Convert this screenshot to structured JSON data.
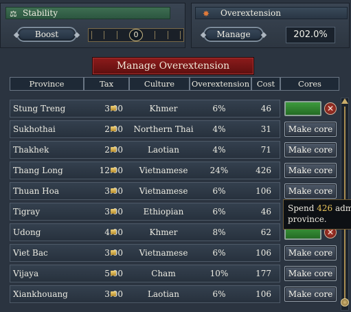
{
  "stability": {
    "title": "Stability",
    "boost_label": "Boost",
    "value": "0"
  },
  "overextension": {
    "title": "Overextension",
    "manage_label": "Manage",
    "value": "202.0%"
  },
  "panel": {
    "title": "Manage Overextension"
  },
  "table": {
    "headers": [
      "Province",
      "Tax",
      "Culture",
      "Overextension",
      "Cost",
      "Cores"
    ],
    "make_core_label": "Make core",
    "rows": [
      {
        "province": "Stung Treng",
        "tax": "3.00",
        "culture": "Khmer",
        "overextension": "6%",
        "cost": "46",
        "action": "coring"
      },
      {
        "province": "Sukhothai",
        "tax": "2.00",
        "culture": "Northern Thai",
        "overextension": "4%",
        "cost": "31",
        "action": "make-core"
      },
      {
        "province": "Thakhek",
        "tax": "2.00",
        "culture": "Laotian",
        "overextension": "4%",
        "cost": "71",
        "action": "make-core"
      },
      {
        "province": "Thang Long",
        "tax": "12.00",
        "culture": "Vietnamese",
        "overextension": "24%",
        "cost": "426",
        "action": "make-core"
      },
      {
        "province": "Thuan Hoa",
        "tax": "3.00",
        "culture": "Vietnamese",
        "overextension": "6%",
        "cost": "106",
        "action": "make-core"
      },
      {
        "province": "Tigray",
        "tax": "3.00",
        "culture": "Ethiopian",
        "overextension": "6%",
        "cost": "46",
        "action": "hidden"
      },
      {
        "province": "Udong",
        "tax": "4.00",
        "culture": "Khmer",
        "overextension": "8%",
        "cost": "62",
        "action": "coring"
      },
      {
        "province": "Viet Bac",
        "tax": "3.00",
        "culture": "Vietnamese",
        "overextension": "6%",
        "cost": "106",
        "action": "make-core"
      },
      {
        "province": "Vijaya",
        "tax": "5.00",
        "culture": "Cham",
        "overextension": "10%",
        "cost": "177",
        "action": "make-core"
      },
      {
        "province": "Xiankhouang",
        "tax": "3.00",
        "culture": "Laotian",
        "overextension": "6%",
        "cost": "106",
        "action": "make-core"
      }
    ]
  },
  "tooltip": {
    "prefix": "Spend ",
    "amount": "426",
    "suffix": " adm",
    "line2": "province."
  },
  "colors": {
    "background": "#2b3440",
    "banner_green": "#3e6e52",
    "title_red": "#8c1b1b",
    "coring_green": "#3d9a3d",
    "accent_gold": "#e7c35a"
  }
}
